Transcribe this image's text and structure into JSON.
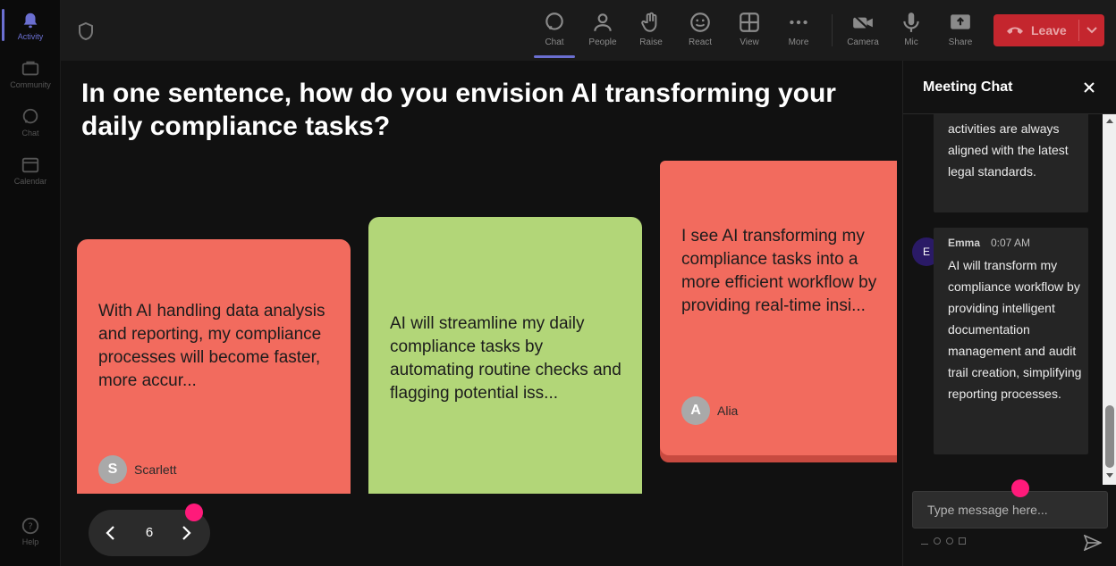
{
  "rail": {
    "items": [
      {
        "label": "Activity",
        "icon": "bell-icon"
      },
      {
        "label": "Community",
        "icon": "community-icon"
      },
      {
        "label": "Chat",
        "icon": "chat-icon"
      },
      {
        "label": "Calendar",
        "icon": "calendar-icon"
      },
      {
        "label": "Help",
        "icon": "help-icon"
      }
    ]
  },
  "toolbar": {
    "chat": "Chat",
    "people": "People",
    "raise": "Raise",
    "react": "React",
    "view": "View",
    "more": "More",
    "camera": "Camera",
    "mic": "Mic",
    "share": "Share",
    "leave": "Leave"
  },
  "stage": {
    "question": "In one sentence, how do you envision AI transforming your daily compliance tasks?",
    "cards": [
      {
        "text": "With AI handling data analysis and reporting, my compliance processes will become faster, more accur...",
        "author": "Scarlett",
        "initial": "S",
        "color": "#f26b5e"
      },
      {
        "text": "AI will streamline my daily compliance tasks by automating routine checks and flagging potential iss...",
        "author": "",
        "initial": "",
        "color": "#b2d678"
      },
      {
        "text": "I see AI transforming my compliance tasks into a more efficient workflow by providing real-time insi...",
        "author": "Alia",
        "initial": "A",
        "color": "#f26b5e"
      }
    ],
    "page_number": "6"
  },
  "chat": {
    "title": "Meeting Chat",
    "messages": [
      {
        "text": "activities are always aligned with the latest legal standards."
      },
      {
        "sender": "Emma",
        "initial": "E",
        "time": "0:07 AM",
        "text": "AI will transform my compliance workflow by providing intelligent documentation management and audit trail creation, simplifying reporting processes."
      }
    ],
    "input_placeholder": "Type message here..."
  },
  "colors": {
    "accent": "#6b6fd1",
    "leave": "#c4262e",
    "highlight_dot": "#ff1a7a"
  }
}
